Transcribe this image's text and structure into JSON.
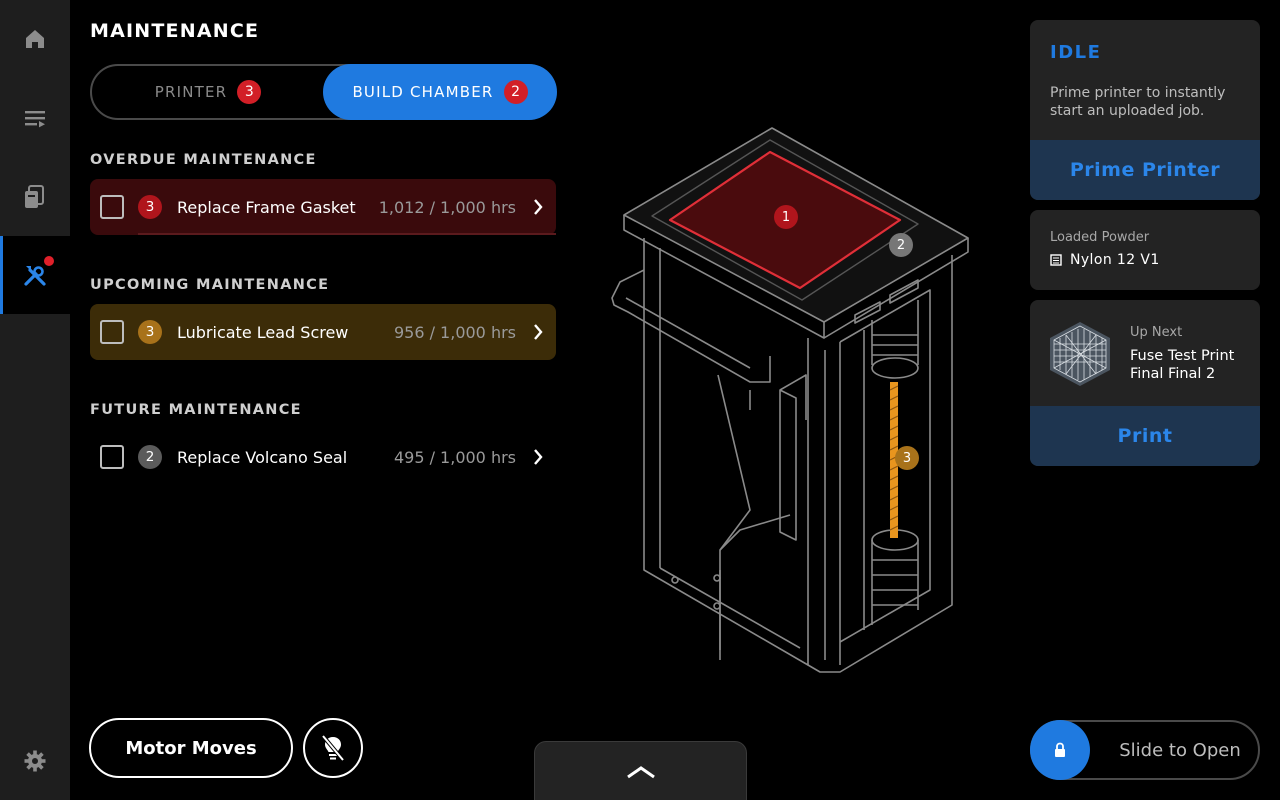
{
  "sidebar": {
    "items": [
      {
        "icon": "home-icon"
      },
      {
        "icon": "queue-icon"
      },
      {
        "icon": "materials-icon"
      },
      {
        "icon": "tools-icon",
        "active": true,
        "has_alert": true
      }
    ],
    "settings_icon": "gear-icon"
  },
  "page": {
    "title": "MAINTENANCE"
  },
  "tabs": {
    "printer": {
      "label": "PRINTER",
      "count": "3"
    },
    "build_chamber": {
      "label": "BUILD CHAMBER",
      "count": "2",
      "selected": true
    }
  },
  "sections": {
    "overdue": {
      "heading": "OVERDUE MAINTENANCE",
      "task": {
        "number": "3",
        "label": "Replace Frame Gasket",
        "hours": "1,012 / 1,000 hrs"
      }
    },
    "upcoming": {
      "heading": "UPCOMING MAINTENANCE",
      "task": {
        "number": "3",
        "label": "Lubricate Lead Screw",
        "hours": "956 / 1,000 hrs"
      }
    },
    "future": {
      "heading": "FUTURE MAINTENANCE",
      "task": {
        "number": "2",
        "label": "Replace Volcano Seal",
        "hours": "495 / 1,000 hrs"
      }
    }
  },
  "diagram": {
    "markers": [
      "1",
      "2",
      "3"
    ]
  },
  "status_card": {
    "status": "IDLE",
    "description": "Prime printer to instantly start an uploaded job.",
    "button": "Prime Printer"
  },
  "powder_card": {
    "label": "Loaded Powder",
    "value": "Nylon 12 V1"
  },
  "job_card": {
    "label": "Up Next",
    "name": "Fuse Test Print Final Final 2",
    "button": "Print"
  },
  "bottom": {
    "motor_moves": "Motor Moves",
    "light_icon": "light-off-icon",
    "drawer_icon": "chevron-up-icon",
    "slider_label": "Slide to Open",
    "slider_icon": "lock-icon"
  },
  "colors": {
    "accent": "#1f7ae0",
    "overdue": "#3a0a0c",
    "upcoming": "#3c2c08",
    "alert": "#d21f27"
  }
}
